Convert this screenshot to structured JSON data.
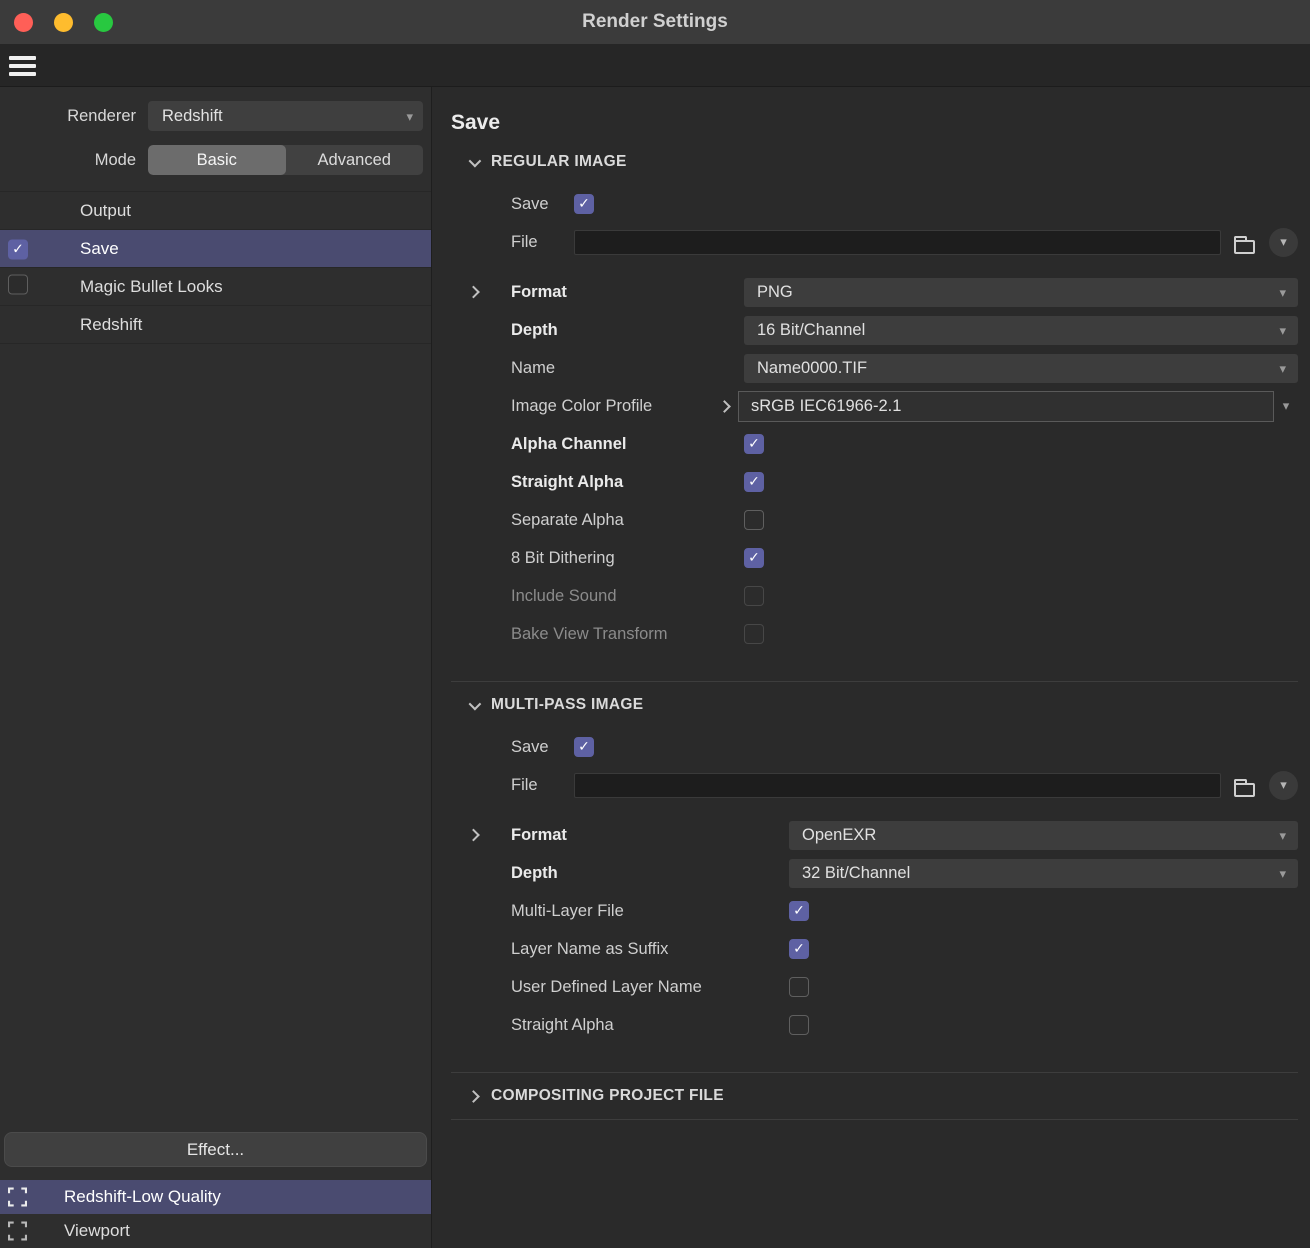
{
  "window": {
    "title": "Render Settings"
  },
  "sidebar": {
    "renderer_label": "Renderer",
    "renderer_value": "Redshift",
    "mode_label": "Mode",
    "mode_basic": "Basic",
    "mode_advanced": "Advanced",
    "items": [
      {
        "label": "Output",
        "selected": false
      },
      {
        "label": "Save",
        "selected": true,
        "checked": true
      },
      {
        "label": "Magic Bullet Looks",
        "selected": false,
        "checked": false
      },
      {
        "label": "Redshift",
        "selected": false
      }
    ],
    "effect_button": "Effect...",
    "render_settings_list": [
      {
        "label": "Redshift-Low Quality",
        "selected": true
      },
      {
        "label": "Viewport",
        "selected": false
      }
    ]
  },
  "main": {
    "title": "Save",
    "regular": {
      "header": "REGULAR IMAGE",
      "save_label": "Save",
      "save_checked": true,
      "file_label": "File",
      "file_value": "",
      "format_label": "Format",
      "format_value": "PNG",
      "depth_label": "Depth",
      "depth_value": "16 Bit/Channel",
      "name_label": "Name",
      "name_value": "Name0000.TIF",
      "profile_label": "Image Color Profile",
      "profile_value": "sRGB IEC61966-2.1",
      "alpha_channel_label": "Alpha Channel",
      "alpha_channel_checked": true,
      "straight_alpha_label": "Straight Alpha",
      "straight_alpha_checked": true,
      "separate_alpha_label": "Separate Alpha",
      "separate_alpha_checked": false,
      "dithering_label": "8 Bit Dithering",
      "dithering_checked": true,
      "include_sound_label": "Include Sound",
      "include_sound_checked": false,
      "bake_view_label": "Bake View Transform",
      "bake_view_checked": false
    },
    "multipass": {
      "header": "MULTI-PASS IMAGE",
      "save_label": "Save",
      "save_checked": true,
      "file_label": "File",
      "file_value": "",
      "format_label": "Format",
      "format_value": "OpenEXR",
      "depth_label": "Depth",
      "depth_value": "32 Bit/Channel",
      "multilayer_label": "Multi-Layer File",
      "multilayer_checked": true,
      "suffix_label": "Layer Name as Suffix",
      "suffix_checked": true,
      "userlayer_label": "User Defined Layer Name",
      "userlayer_checked": false,
      "straight_alpha_label": "Straight Alpha",
      "straight_alpha_checked": false
    },
    "compositing": {
      "header": "COMPOSITING PROJECT FILE"
    }
  },
  "colors": {
    "accent_checkbox": "#5e61a3",
    "selection": "#4a4b70",
    "traffic_red": "#ff5f57",
    "traffic_yellow": "#febc2e",
    "traffic_green": "#28c840"
  }
}
